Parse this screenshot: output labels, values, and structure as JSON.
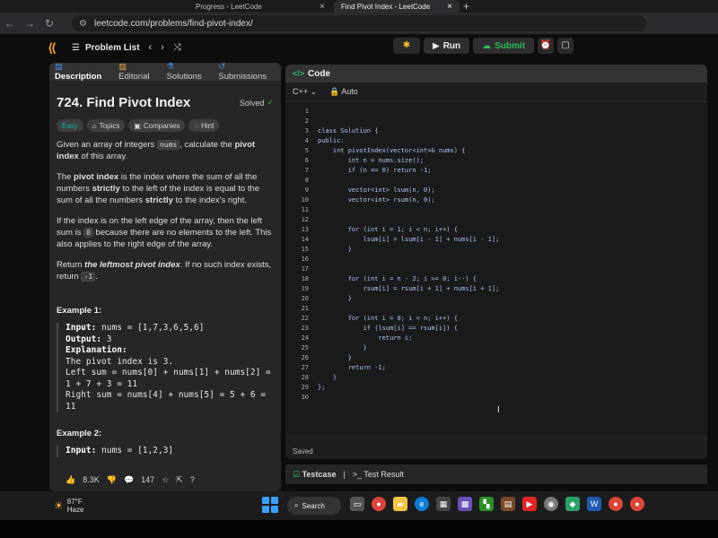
{
  "browser": {
    "tabs": [
      {
        "label": "Progress - LeetCode",
        "close": "×"
      },
      {
        "label": "Find Pivot Index - LeetCode",
        "close": "×"
      }
    ],
    "new_tab": "+",
    "url": "leetcode.com/problems/find-pivot-index/"
  },
  "nav": {
    "problem_list": "Problem List",
    "run": "Run",
    "submit": "Submit"
  },
  "left": {
    "tabs": [
      {
        "label": "Description"
      },
      {
        "label": "Editorial"
      },
      {
        "label": "Solutions"
      },
      {
        "label": "Submissions"
      }
    ],
    "title": "724. Find Pivot Index",
    "solved": "Solved",
    "badges": [
      "Easy",
      "Topics",
      "Companies",
      "Hint"
    ],
    "desc": {
      "p1a": "Given an array of integers ",
      "p1code": "nums",
      "p1b": ", calculate the ",
      "p1bold": "pivot index",
      "p1c": " of this array.",
      "p2a": "The ",
      "p2bold1": "pivot index",
      "p2b": " is the index where the sum of all the numbers ",
      "p2bold2": "strictly",
      "p2c": " to the left of the index is equal to the sum of all the numbers ",
      "p2bold3": "strictly",
      "p2d": " to the index's right.",
      "p3a": "If the index is on the left edge of the array, then the left sum is ",
      "p3code": "0",
      "p3b": " because there are no elements to the left. This also applies to the right edge of the array.",
      "p4a": "Return ",
      "p4bold": "the leftmost pivot index",
      "p4b": ". If no such index exists, return ",
      "p4code": "-1",
      "p4c": "."
    },
    "example1": {
      "title": "Example 1:",
      "lines": [
        {
          "label": "Input:",
          "text": " nums = [1,7,3,6,5,6]"
        },
        {
          "label": "Output:",
          "text": " 3"
        },
        {
          "label": "Explanation:",
          "text": ""
        },
        {
          "label": "",
          "text": "The pivot index is 3."
        },
        {
          "label": "",
          "text": "Left sum = nums[0] + nums[1] + nums[2] ="
        },
        {
          "label": "",
          "text": "1 + 7 + 3 = 11"
        },
        {
          "label": "",
          "text": "Right sum = nums[4] + nums[5] = 5 + 6 ="
        },
        {
          "label": "",
          "text": "11"
        }
      ]
    },
    "example2": {
      "title": "Example 2:",
      "input_label": "Input:",
      "input": " nums = [1,2,3]"
    },
    "stats": {
      "likes": "8.3K",
      "comments": "147"
    }
  },
  "right": {
    "header": "Code",
    "lang": "C++",
    "auto": "Auto",
    "code": [
      "",
      "",
      "class Solution {",
      "public:",
      "    int pivotIndex(vector<int>& nums) {",
      "        int n = nums.size();",
      "        if (n == 0) return -1;",
      "",
      "        vector<int> lsum(n, 0);",
      "        vector<int> rsum(n, 0);",
      "",
      "",
      "        for (int i = 1; i < n; i++) {",
      "            lsum[i] = lsum[i - 1] + nums[i - 1];",
      "        }",
      "",
      "",
      "        for (int i = n - 2; i >= 0; i--) {",
      "            rsum[i] = rsum[i + 1] + nums[i + 1];",
      "        }",
      "",
      "        for (int i = 0; i < n; i++) {",
      "            if (lsum[i] == rsum[i]) {",
      "                return i;",
      "            }",
      "        }",
      "        return -1;",
      "    }",
      "};",
      ""
    ],
    "saved": "Saved",
    "testcase": "Testcase",
    "test_result": "Test Result"
  },
  "taskbar": {
    "temp": "87°F",
    "weather": "Haze",
    "search": "Search"
  }
}
